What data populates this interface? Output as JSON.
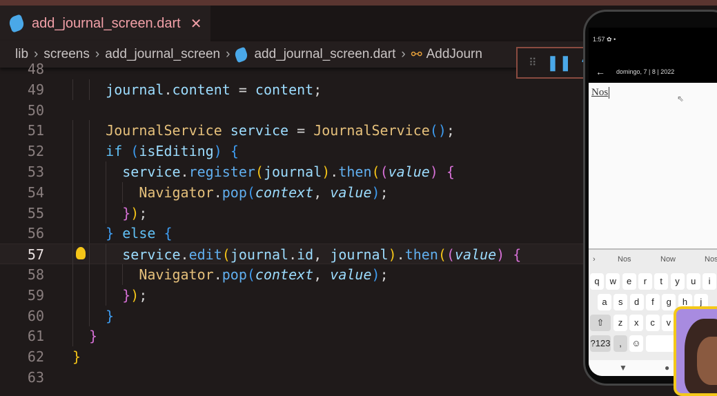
{
  "tab": {
    "title": "add_journal_screen.dart",
    "close_icon": "close-icon"
  },
  "breadcrumb": [
    "lib",
    "screens",
    "add_journal_screen",
    "add_journal_screen.dart",
    "AddJourn"
  ],
  "current_line": 57,
  "lines": [
    {
      "n": 48,
      "indent": 0,
      "tokens": []
    },
    {
      "n": 49,
      "indent": 4,
      "tokens": [
        [
          "journal",
          "v"
        ],
        [
          ".",
          "p"
        ],
        [
          "content",
          "v"
        ],
        [
          " = ",
          "p"
        ],
        [
          "content",
          "v"
        ],
        [
          ";",
          "p"
        ]
      ]
    },
    {
      "n": 50,
      "indent": 0,
      "tokens": []
    },
    {
      "n": 51,
      "indent": 4,
      "tokens": [
        [
          "JournalService",
          "t"
        ],
        [
          " ",
          "p"
        ],
        [
          "service",
          "v"
        ],
        [
          " = ",
          "p"
        ],
        [
          "JournalService",
          "t"
        ],
        [
          "()",
          "b3"
        ],
        [
          ";",
          "p"
        ]
      ]
    },
    {
      "n": 52,
      "indent": 4,
      "tokens": [
        [
          "if",
          "k"
        ],
        [
          " ",
          "p"
        ],
        [
          "(",
          "b3"
        ],
        [
          "isEditing",
          "v"
        ],
        [
          ")",
          "b3"
        ],
        [
          " ",
          "p"
        ],
        [
          "{",
          "b3"
        ]
      ]
    },
    {
      "n": 53,
      "indent": 6,
      "tokens": [
        [
          "service",
          "v"
        ],
        [
          ".",
          "p"
        ],
        [
          "register",
          "f"
        ],
        [
          "(",
          "b1"
        ],
        [
          "journal",
          "v"
        ],
        [
          ")",
          "b1"
        ],
        [
          ".",
          "p"
        ],
        [
          "then",
          "f"
        ],
        [
          "(",
          "b1"
        ],
        [
          "(",
          "b2"
        ],
        [
          "value",
          "i"
        ],
        [
          ")",
          "b2"
        ],
        [
          " ",
          "p"
        ],
        [
          "{",
          "b2"
        ]
      ]
    },
    {
      "n": 54,
      "indent": 8,
      "tokens": [
        [
          "Navigator",
          "t"
        ],
        [
          ".",
          "p"
        ],
        [
          "pop",
          "f"
        ],
        [
          "(",
          "b3"
        ],
        [
          "context",
          "i"
        ],
        [
          ", ",
          "p"
        ],
        [
          "value",
          "i"
        ],
        [
          ")",
          "b3"
        ],
        [
          ";",
          "p"
        ]
      ]
    },
    {
      "n": 55,
      "indent": 6,
      "tokens": [
        [
          "}",
          "b2"
        ],
        [
          ")",
          "b1"
        ],
        [
          ";",
          "p"
        ]
      ]
    },
    {
      "n": 56,
      "indent": 4,
      "tokens": [
        [
          "}",
          "b3"
        ],
        [
          " ",
          "p"
        ],
        [
          "else",
          "k"
        ],
        [
          " ",
          "p"
        ],
        [
          "{",
          "b3"
        ]
      ]
    },
    {
      "n": 57,
      "indent": 6,
      "tokens": [
        [
          "service",
          "v"
        ],
        [
          ".",
          "p"
        ],
        [
          "edit",
          "f"
        ],
        [
          "(",
          "b1"
        ],
        [
          "journal",
          "v"
        ],
        [
          ".",
          "p"
        ],
        [
          "id",
          "v"
        ],
        [
          ", ",
          "p"
        ],
        [
          "journal",
          "v"
        ],
        [
          ")",
          "b1"
        ],
        [
          ".",
          "p"
        ],
        [
          "then",
          "f"
        ],
        [
          "(",
          "b1"
        ],
        [
          "(",
          "b2"
        ],
        [
          "value",
          "i"
        ],
        [
          ")",
          "b2"
        ],
        [
          " ",
          "p"
        ],
        [
          "{",
          "b2"
        ]
      ]
    },
    {
      "n": 58,
      "indent": 8,
      "tokens": [
        [
          "Navigator",
          "t"
        ],
        [
          ".",
          "p"
        ],
        [
          "pop",
          "f"
        ],
        [
          "(",
          "b3"
        ],
        [
          "context",
          "i"
        ],
        [
          ", ",
          "p"
        ],
        [
          "value",
          "i"
        ],
        [
          ")",
          "b3"
        ],
        [
          ";",
          "p"
        ]
      ]
    },
    {
      "n": 59,
      "indent": 6,
      "tokens": [
        [
          "}",
          "b2"
        ],
        [
          ")",
          "b1"
        ],
        [
          ";",
          "p"
        ]
      ]
    },
    {
      "n": 60,
      "indent": 4,
      "tokens": [
        [
          "}",
          "b3"
        ]
      ]
    },
    {
      "n": 61,
      "indent": 2,
      "tokens": [
        [
          "}",
          "b2"
        ]
      ]
    },
    {
      "n": 62,
      "indent": 0,
      "tokens": [
        [
          "}",
          "b1"
        ]
      ]
    },
    {
      "n": 63,
      "indent": 0,
      "tokens": []
    }
  ],
  "phone": {
    "time": "1:57",
    "date": "domingo, 7 | 8 | 2022",
    "typed": "Nos",
    "suggestions": [
      "Nos",
      "Now",
      "Nos"
    ],
    "row1": [
      "q",
      "w",
      "e",
      "r",
      "t",
      "y",
      "u",
      "i"
    ],
    "row2": [
      "a",
      "s",
      "d",
      "f",
      "g",
      "h",
      "j"
    ],
    "row3": [
      "z",
      "x",
      "c",
      "v"
    ],
    "sym_key": "?123",
    "comma_key": ","
  }
}
